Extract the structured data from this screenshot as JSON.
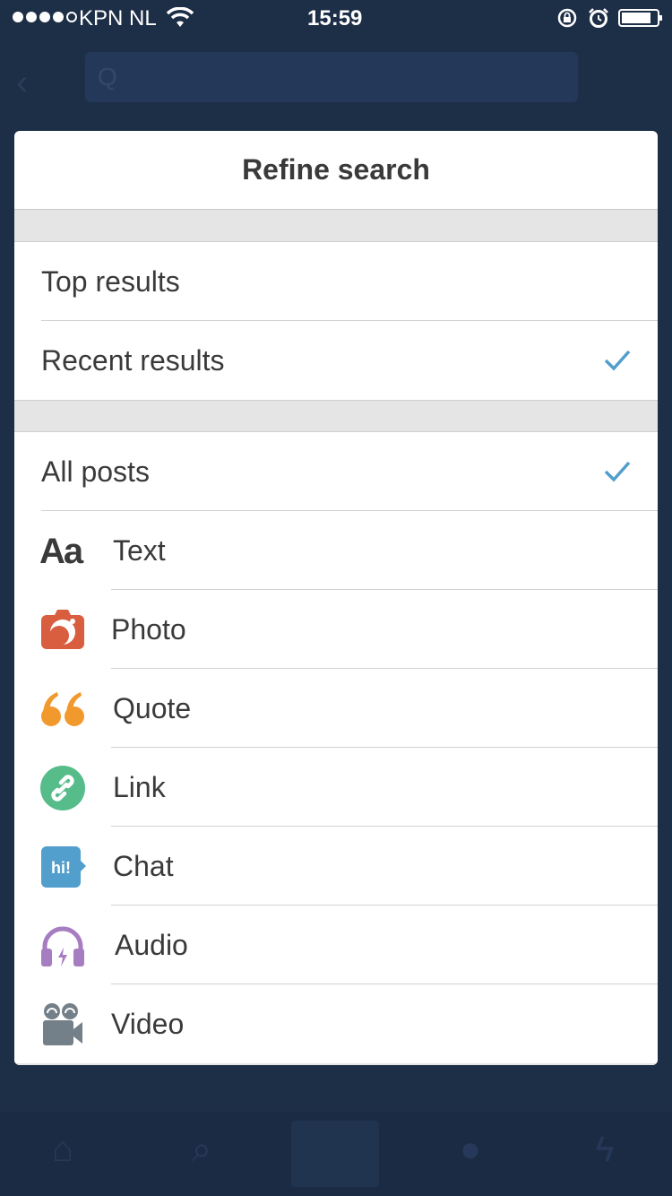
{
  "status_bar": {
    "carrier": "KPN NL",
    "time": "15:59"
  },
  "background": {
    "search_text": "Q"
  },
  "modal": {
    "title": "Refine search",
    "sort_options": [
      {
        "label": "Top results",
        "checked": false
      },
      {
        "label": "Recent results",
        "checked": true
      }
    ],
    "filter_all": {
      "label": "All posts",
      "checked": true
    },
    "post_types": [
      {
        "label": "Text",
        "icon": "text-aa-icon",
        "color": "#3a3a3a"
      },
      {
        "label": "Photo",
        "icon": "camera-icon",
        "color": "#d95e40"
      },
      {
        "label": "Quote",
        "icon": "quote-icon",
        "color": "#f2992e"
      },
      {
        "label": "Link",
        "icon": "link-icon",
        "color": "#56bc8a"
      },
      {
        "label": "Chat",
        "icon": "chat-bubble-icon",
        "color": "#529ecc"
      },
      {
        "label": "Audio",
        "icon": "headphones-icon",
        "color": "#a77dc2"
      },
      {
        "label": "Video",
        "icon": "video-camera-icon",
        "color": "#748089"
      }
    ],
    "check_color": "#529ecc"
  }
}
